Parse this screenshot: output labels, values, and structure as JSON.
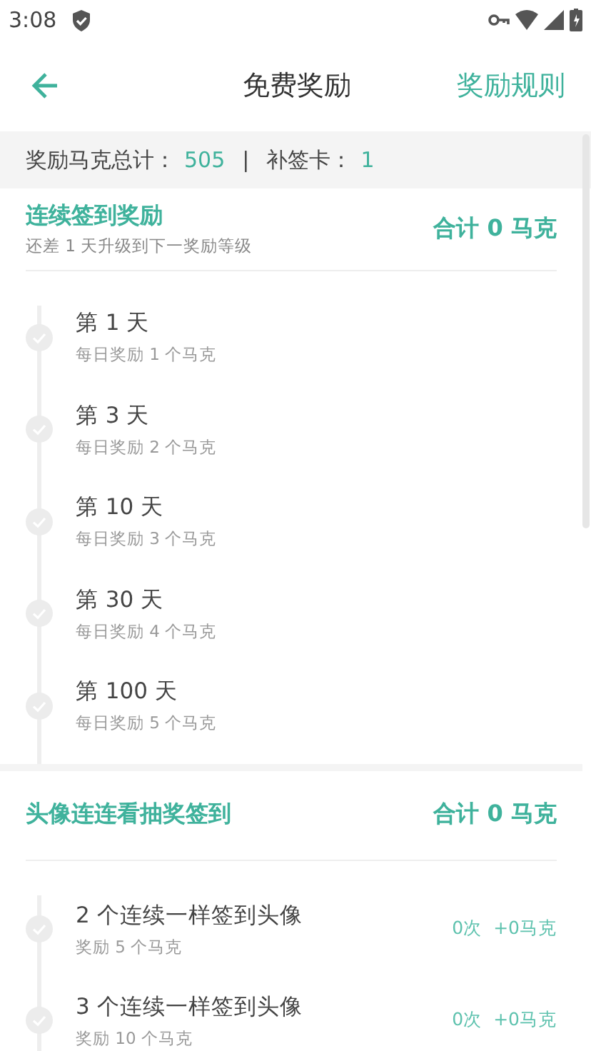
{
  "status_bar": {
    "time": "3:08"
  },
  "app_bar": {
    "title": "免费奖励",
    "action": "奖励规则"
  },
  "summary": {
    "total_label": "奖励马克总计：",
    "total_value": "505",
    "separator": "|",
    "card_label": "补签卡：",
    "card_value": "1"
  },
  "sections": [
    {
      "kind": "streak",
      "title": "连续签到奖励",
      "subtitle": "还差 1 天升级到下一奖励等级",
      "total": "合计 0 马克",
      "items": [
        {
          "title": "第 1 天",
          "detail": "每日奖励 1 个马克",
          "done": false
        },
        {
          "title": "第 3 天",
          "detail": "每日奖励 2 个马克",
          "done": false
        },
        {
          "title": "第 10 天",
          "detail": "每日奖励 3 个马克",
          "done": false
        },
        {
          "title": "第 30 天",
          "detail": "每日奖励 4 个马克",
          "done": false
        },
        {
          "title": "第 100 天",
          "detail": "每日奖励 5 个马克",
          "done": false
        }
      ]
    },
    {
      "kind": "lottery",
      "title": "头像连连看抽奖签到",
      "total": "合计 0 马克",
      "items": [
        {
          "title": "2 个连续一样签到头像",
          "detail": "奖励 5 个马克",
          "done": false,
          "count": "0次",
          "gain": "+0马克"
        },
        {
          "title": "3 个连续一样签到头像",
          "detail": "奖励 10 个马克",
          "done": false,
          "count": "0次",
          "gain": "+0马克"
        }
      ]
    }
  ]
}
